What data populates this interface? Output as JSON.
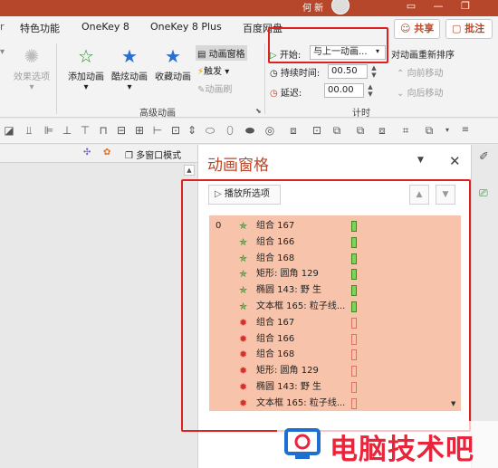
{
  "titlebar": {
    "user_name": "何 新",
    "min": "—",
    "restore": "❐"
  },
  "tabs": [
    "特色功能",
    "OneKey 8",
    "OneKey 8 Plus",
    "百度网盘"
  ],
  "share_label": "共享",
  "comment_label": "批注",
  "ribbon": {
    "effect_options": "效果选项",
    "add_animation": "添加动画",
    "cool_animation": "酷炫动画",
    "fav_animation": "收藏动画",
    "anim_pane": "动画窗格",
    "trigger": "触发",
    "anim_painter": "动画刷",
    "advanced_group": "高级动画",
    "start_label": "开始:",
    "start_value": "与上一动画...",
    "duration_label": "持续时间:",
    "duration_value": "00.50",
    "delay_label": "延迟:",
    "delay_value": "00.00",
    "reorder_label": "对动画重新排序",
    "move_earlier": "向前移动",
    "move_later": "向后移动",
    "timing_group": "计时"
  },
  "slide_toolbar": {
    "multiwindow": "多窗口模式"
  },
  "pane": {
    "title": "动画窗格",
    "play_label": "播放所选项",
    "first_number": "0",
    "items": [
      {
        "name": "组合 167",
        "kind": "entrance"
      },
      {
        "name": "组合 166",
        "kind": "entrance"
      },
      {
        "name": "组合 168",
        "kind": "entrance"
      },
      {
        "name": "矩形: 圆角 129",
        "kind": "entrance"
      },
      {
        "name": "椭圆 143: 野 生",
        "kind": "entrance"
      },
      {
        "name": "文本框 165: 粒子线...",
        "kind": "entrance"
      },
      {
        "name": "组合 167",
        "kind": "exit"
      },
      {
        "name": "组合 166",
        "kind": "exit"
      },
      {
        "name": "组合 168",
        "kind": "exit"
      },
      {
        "name": "矩形: 圆角 129",
        "kind": "exit"
      },
      {
        "name": "椭圆 143: 野 生",
        "kind": "exit"
      },
      {
        "name": "文本框 165: 粒子线...",
        "kind": "exit"
      }
    ]
  },
  "watermark": {
    "text": "电脑技术吧"
  },
  "colors": {
    "accent": "#b7472a",
    "list_bg": "#f7c4ab",
    "entrance_bar": "#7fd35a",
    "exit_bar": "#e07060",
    "highlight_box": "#e02020"
  },
  "icons": {
    "entrance": "green-star-icon",
    "exit": "red-burst-icon"
  }
}
